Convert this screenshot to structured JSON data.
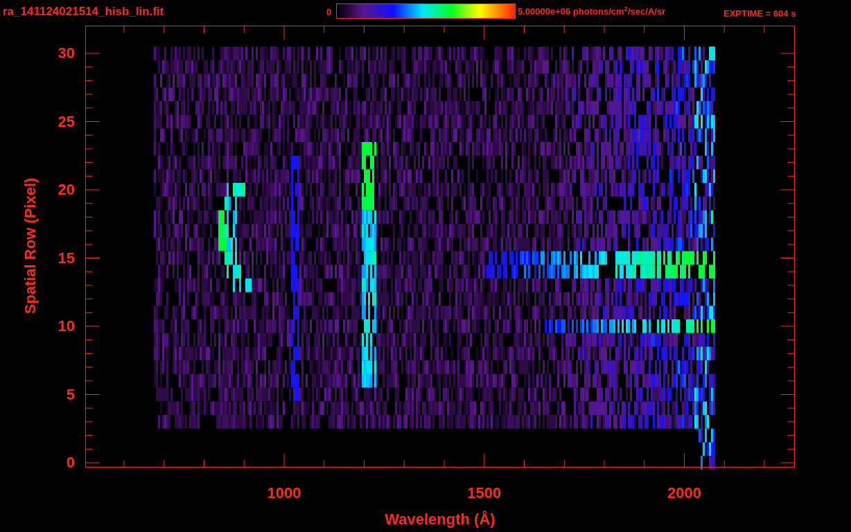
{
  "title": "ra_141124021514_hisb_lin.fit",
  "colorbar": {
    "min_label": "0",
    "max_label": "5.00000e+06 photons/cm$^{2}$/sec/A/sr"
  },
  "exposure": "EXPTIME = 604 s",
  "plot": {
    "ylabel": "Spatial Row (Pixel)",
    "xlabel": "Wavelength (Å)",
    "yticks": [
      "30",
      "25",
      "20",
      "15",
      "10",
      "5",
      "0"
    ],
    "xticks": [
      "1000",
      "1500",
      "2000"
    ]
  }
}
